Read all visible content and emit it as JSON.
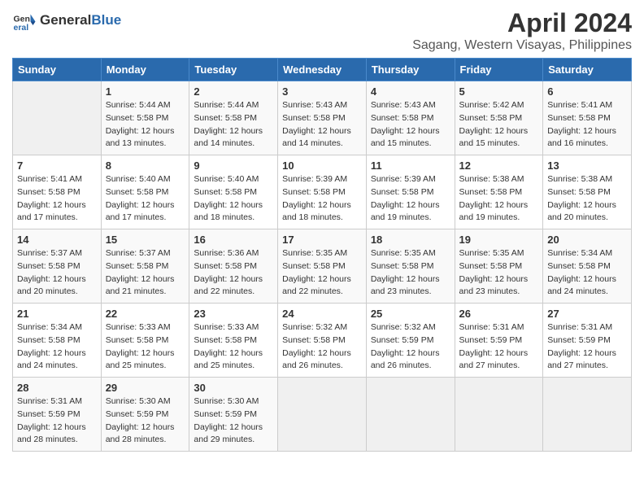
{
  "header": {
    "logo_general": "General",
    "logo_blue": "Blue",
    "month": "April 2024",
    "location": "Sagang, Western Visayas, Philippines"
  },
  "days_of_week": [
    "Sunday",
    "Monday",
    "Tuesday",
    "Wednesday",
    "Thursday",
    "Friday",
    "Saturday"
  ],
  "weeks": [
    [
      {
        "day": "",
        "info": ""
      },
      {
        "day": "1",
        "info": "Sunrise: 5:44 AM\nSunset: 5:58 PM\nDaylight: 12 hours\nand 13 minutes."
      },
      {
        "day": "2",
        "info": "Sunrise: 5:44 AM\nSunset: 5:58 PM\nDaylight: 12 hours\nand 14 minutes."
      },
      {
        "day": "3",
        "info": "Sunrise: 5:43 AM\nSunset: 5:58 PM\nDaylight: 12 hours\nand 14 minutes."
      },
      {
        "day": "4",
        "info": "Sunrise: 5:43 AM\nSunset: 5:58 PM\nDaylight: 12 hours\nand 15 minutes."
      },
      {
        "day": "5",
        "info": "Sunrise: 5:42 AM\nSunset: 5:58 PM\nDaylight: 12 hours\nand 15 minutes."
      },
      {
        "day": "6",
        "info": "Sunrise: 5:41 AM\nSunset: 5:58 PM\nDaylight: 12 hours\nand 16 minutes."
      }
    ],
    [
      {
        "day": "7",
        "info": "Sunrise: 5:41 AM\nSunset: 5:58 PM\nDaylight: 12 hours\nand 17 minutes."
      },
      {
        "day": "8",
        "info": "Sunrise: 5:40 AM\nSunset: 5:58 PM\nDaylight: 12 hours\nand 17 minutes."
      },
      {
        "day": "9",
        "info": "Sunrise: 5:40 AM\nSunset: 5:58 PM\nDaylight: 12 hours\nand 18 minutes."
      },
      {
        "day": "10",
        "info": "Sunrise: 5:39 AM\nSunset: 5:58 PM\nDaylight: 12 hours\nand 18 minutes."
      },
      {
        "day": "11",
        "info": "Sunrise: 5:39 AM\nSunset: 5:58 PM\nDaylight: 12 hours\nand 19 minutes."
      },
      {
        "day": "12",
        "info": "Sunrise: 5:38 AM\nSunset: 5:58 PM\nDaylight: 12 hours\nand 19 minutes."
      },
      {
        "day": "13",
        "info": "Sunrise: 5:38 AM\nSunset: 5:58 PM\nDaylight: 12 hours\nand 20 minutes."
      }
    ],
    [
      {
        "day": "14",
        "info": "Sunrise: 5:37 AM\nSunset: 5:58 PM\nDaylight: 12 hours\nand 20 minutes."
      },
      {
        "day": "15",
        "info": "Sunrise: 5:37 AM\nSunset: 5:58 PM\nDaylight: 12 hours\nand 21 minutes."
      },
      {
        "day": "16",
        "info": "Sunrise: 5:36 AM\nSunset: 5:58 PM\nDaylight: 12 hours\nand 22 minutes."
      },
      {
        "day": "17",
        "info": "Sunrise: 5:35 AM\nSunset: 5:58 PM\nDaylight: 12 hours\nand 22 minutes."
      },
      {
        "day": "18",
        "info": "Sunrise: 5:35 AM\nSunset: 5:58 PM\nDaylight: 12 hours\nand 23 minutes."
      },
      {
        "day": "19",
        "info": "Sunrise: 5:35 AM\nSunset: 5:58 PM\nDaylight: 12 hours\nand 23 minutes."
      },
      {
        "day": "20",
        "info": "Sunrise: 5:34 AM\nSunset: 5:58 PM\nDaylight: 12 hours\nand 24 minutes."
      }
    ],
    [
      {
        "day": "21",
        "info": "Sunrise: 5:34 AM\nSunset: 5:58 PM\nDaylight: 12 hours\nand 24 minutes."
      },
      {
        "day": "22",
        "info": "Sunrise: 5:33 AM\nSunset: 5:58 PM\nDaylight: 12 hours\nand 25 minutes."
      },
      {
        "day": "23",
        "info": "Sunrise: 5:33 AM\nSunset: 5:58 PM\nDaylight: 12 hours\nand 25 minutes."
      },
      {
        "day": "24",
        "info": "Sunrise: 5:32 AM\nSunset: 5:58 PM\nDaylight: 12 hours\nand 26 minutes."
      },
      {
        "day": "25",
        "info": "Sunrise: 5:32 AM\nSunset: 5:59 PM\nDaylight: 12 hours\nand 26 minutes."
      },
      {
        "day": "26",
        "info": "Sunrise: 5:31 AM\nSunset: 5:59 PM\nDaylight: 12 hours\nand 27 minutes."
      },
      {
        "day": "27",
        "info": "Sunrise: 5:31 AM\nSunset: 5:59 PM\nDaylight: 12 hours\nand 27 minutes."
      }
    ],
    [
      {
        "day": "28",
        "info": "Sunrise: 5:31 AM\nSunset: 5:59 PM\nDaylight: 12 hours\nand 28 minutes."
      },
      {
        "day": "29",
        "info": "Sunrise: 5:30 AM\nSunset: 5:59 PM\nDaylight: 12 hours\nand 28 minutes."
      },
      {
        "day": "30",
        "info": "Sunrise: 5:30 AM\nSunset: 5:59 PM\nDaylight: 12 hours\nand 29 minutes."
      },
      {
        "day": "",
        "info": ""
      },
      {
        "day": "",
        "info": ""
      },
      {
        "day": "",
        "info": ""
      },
      {
        "day": "",
        "info": ""
      }
    ]
  ]
}
